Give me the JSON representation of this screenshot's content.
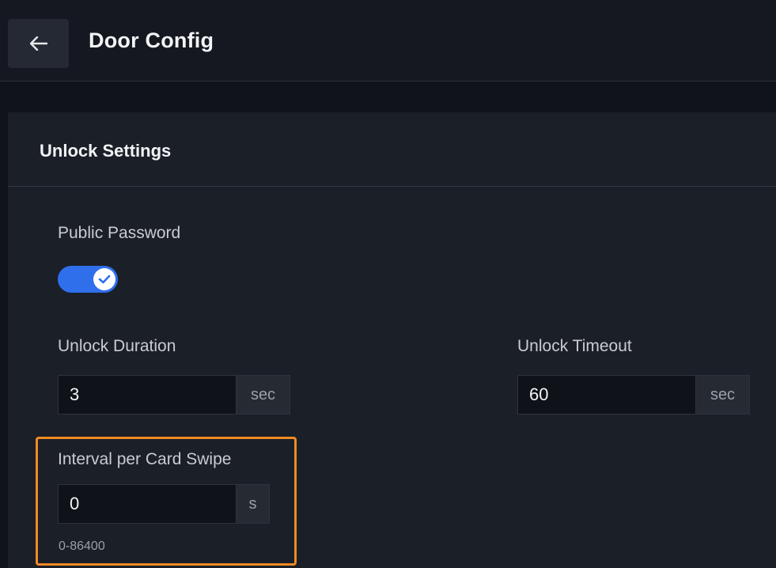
{
  "header": {
    "back_icon": "arrow-left-icon",
    "title": "Door Config"
  },
  "panel": {
    "title": "Unlock Settings"
  },
  "public_password": {
    "label": "Public Password",
    "enabled": true,
    "toggle_color": "#2f6fec",
    "check_icon": "check-icon"
  },
  "unlock_duration": {
    "label": "Unlock Duration",
    "value": "3",
    "unit": "sec"
  },
  "unlock_timeout": {
    "label": "Unlock Timeout",
    "value": "60",
    "unit": "sec"
  },
  "interval_per_card_swipe": {
    "label": "Interval per Card Swipe",
    "value": "0",
    "unit": "s",
    "range_hint": "0-86400",
    "highlight_color": "#f08a24"
  }
}
